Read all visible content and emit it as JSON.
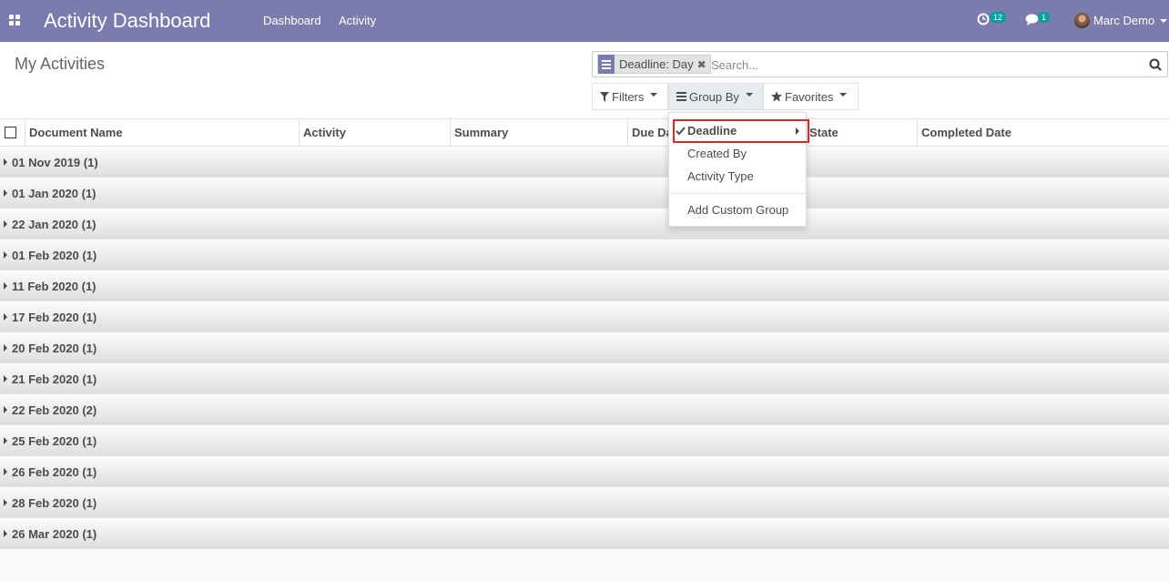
{
  "navbar": {
    "app_title": "Activity Dashboard",
    "menu": [
      "Dashboard",
      "Activity"
    ],
    "activity_count": "12",
    "message_count": "1",
    "user_name": "Marc Demo",
    "brand_color": "#7c7bad"
  },
  "control_panel": {
    "breadcrumb": "My Activities",
    "facet_value": "Deadline: Day",
    "search_placeholder": "Search...",
    "filters_label": "Filters",
    "group_by_label": "Group By",
    "favorites_label": "Favorites"
  },
  "table": {
    "columns": [
      "Document Name",
      "Activity",
      "Summary",
      "Due Date",
      "State",
      "Completed Date"
    ],
    "groups": [
      "01 Nov 2019 (1)",
      "01 Jan 2020 (1)",
      "22 Jan 2020 (1)",
      "01 Feb 2020 (1)",
      "11 Feb 2020 (1)",
      "17 Feb 2020 (1)",
      "20 Feb 2020 (1)",
      "21 Feb 2020 (1)",
      "22 Feb 2020 (2)",
      "25 Feb 2020 (1)",
      "26 Feb 2020 (1)",
      "28 Feb 2020 (1)",
      "26 Mar 2020 (1)"
    ]
  },
  "group_by_menu": {
    "items": [
      "Deadline",
      "Created By",
      "Activity Type"
    ],
    "custom_group_label": "Add Custom Group",
    "highlight_color": "#d9282a"
  }
}
